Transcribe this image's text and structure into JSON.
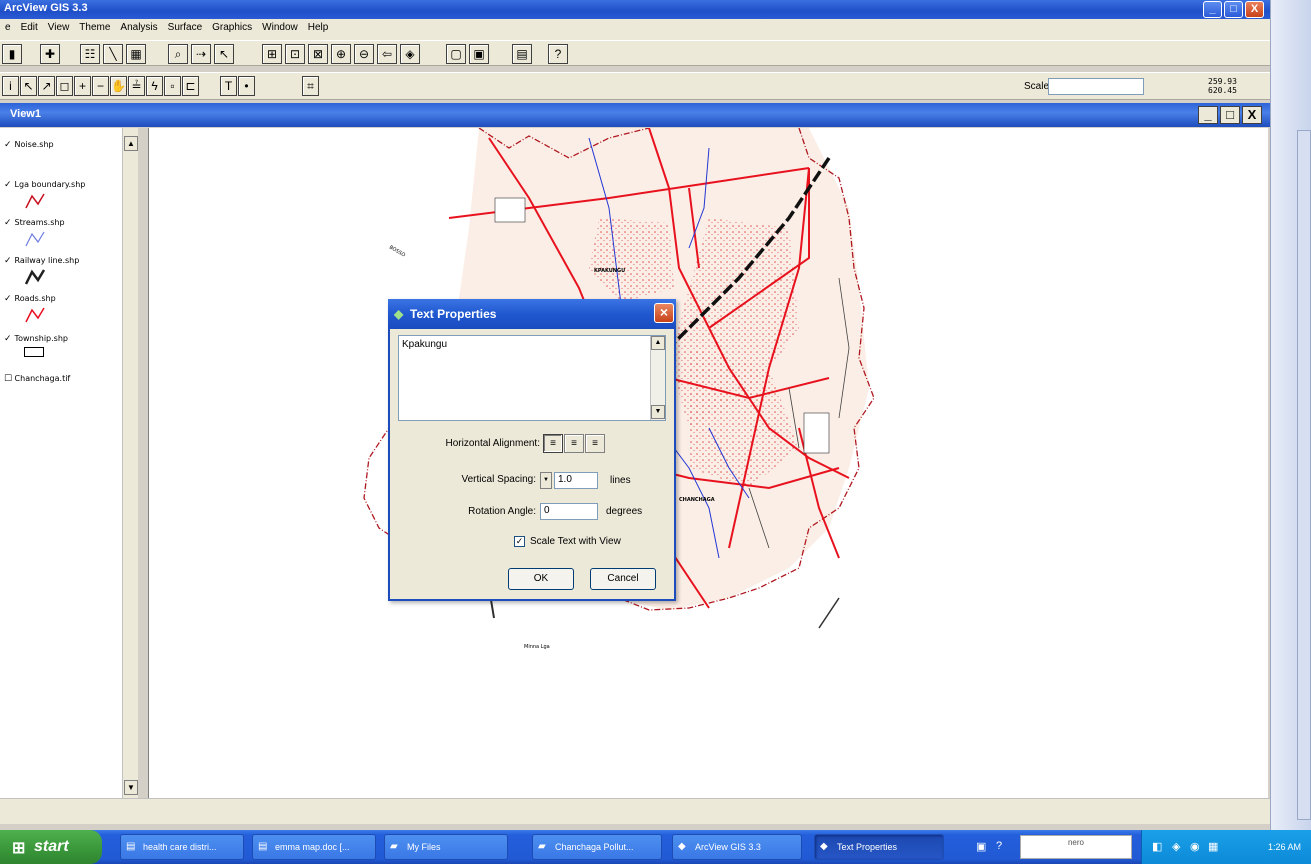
{
  "app": {
    "title": "ArcView GIS 3.3",
    "win_minimize": "_",
    "win_maximize": "□",
    "win_close": "X"
  },
  "menu": [
    "e",
    "Edit",
    "View",
    "Theme",
    "Analysis",
    "Surface",
    "Graphics",
    "Window",
    "Help"
  ],
  "toolbar": {
    "scale_label": "Scale 1:",
    "scale_value": "",
    "coord_x": "259.93",
    "coord_y": "620.45"
  },
  "view": {
    "title": "View1",
    "minimize": "_",
    "maximize": "□",
    "close": "X"
  },
  "toc": {
    "themes": [
      {
        "name": "Noise.shp",
        "checked": true,
        "legend": "none"
      },
      {
        "name": "Lga boundary.shp",
        "checked": true,
        "legend": "red-line"
      },
      {
        "name": "Streams.shp",
        "checked": true,
        "legend": "blue-line"
      },
      {
        "name": "Railway line.shp",
        "checked": true,
        "legend": "black-line"
      },
      {
        "name": "Roads.shp",
        "checked": true,
        "legend": "red-line"
      },
      {
        "name": "Township.shp",
        "checked": true,
        "legend": "rect"
      },
      {
        "name": "Chanchaga.tif",
        "checked": false,
        "legend": "none"
      }
    ]
  },
  "map_labels": [
    {
      "text": "BOSSO"
    },
    {
      "text": "KPAKUNGU"
    },
    {
      "text": "CHANCHAGA"
    },
    {
      "text": "Minna Lga"
    }
  ],
  "dialog": {
    "title": "Text Properties",
    "text_value": "Kpakungu",
    "halign_label": "Horizontal Alignment:",
    "vspacing_label": "Vertical Spacing:",
    "vspacing_value": "1.0",
    "vspacing_unit": "lines",
    "rotation_label": "Rotation Angle:",
    "rotation_value": "0",
    "rotation_unit": "degrees",
    "scale_text_label": "Scale Text with View",
    "scale_text_checked": true,
    "ok_label": "OK",
    "cancel_label": "Cancel"
  },
  "taskbar": {
    "start_label": "start",
    "tasks": [
      {
        "label": "health care distri...",
        "icon": "word-icon"
      },
      {
        "label": "emma map.doc [...",
        "icon": "word-icon"
      },
      {
        "label": "My Files",
        "icon": "folder-icon"
      },
      {
        "label": "Chanchaga Pollut...",
        "icon": "folder-icon"
      },
      {
        "label": "ArcView GIS 3.3",
        "icon": "arcview-icon"
      },
      {
        "label": "Text Properties",
        "icon": "arcview-icon",
        "active": true
      }
    ],
    "nero_label": "nero",
    "clock": "1:26 AM"
  },
  "colors": {
    "xp_blue": "#245edb",
    "map_road": "#e8121e",
    "map_stream": "#2236d6",
    "map_fill": "#fbeee6"
  }
}
